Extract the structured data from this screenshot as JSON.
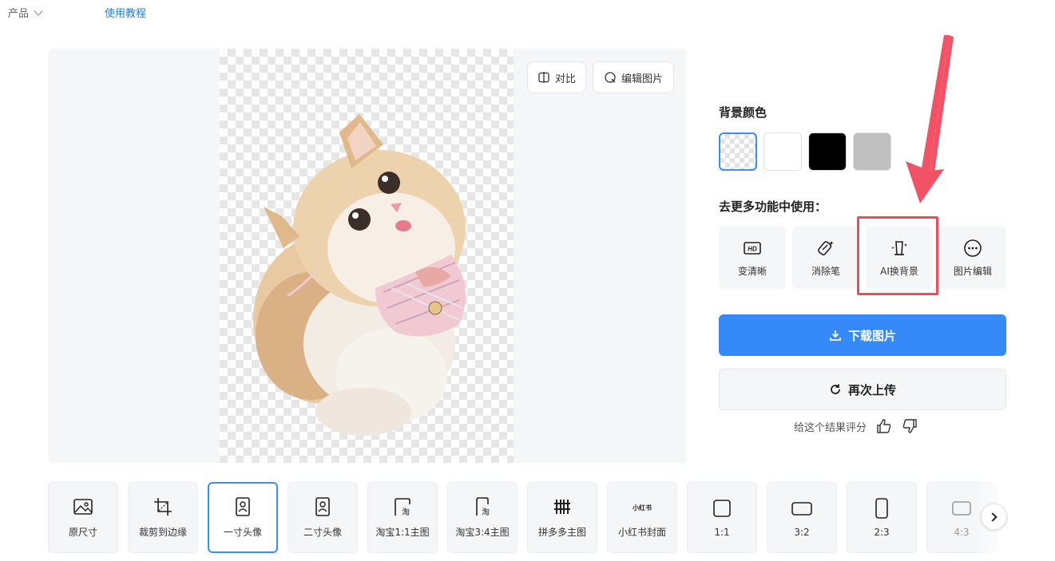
{
  "nav": {
    "product_label": "产品",
    "tutorial_label": "使用教程"
  },
  "preview": {
    "compare_label": "对比",
    "edit_label": "编辑图片"
  },
  "background": {
    "title": "背景颜色",
    "swatches": [
      {
        "name": "transparent",
        "color": "transparent",
        "selected": true
      },
      {
        "name": "white",
        "color": "#ffffff",
        "selected": false
      },
      {
        "name": "black",
        "color": "#000000",
        "selected": false
      },
      {
        "name": "gray",
        "color": "#bfbfbf",
        "selected": false
      }
    ]
  },
  "more_features": {
    "title": "去更多功能中使用：",
    "items": [
      {
        "label": "变清晰",
        "icon": "hd-icon"
      },
      {
        "label": "消除笔",
        "icon": "eraser-icon"
      },
      {
        "label": "AI换背景",
        "icon": "ai-background-icon",
        "highlighted": true
      },
      {
        "label": "图片编辑",
        "icon": "more-dots-icon"
      }
    ]
  },
  "actions": {
    "download_label": "下载图片",
    "reupload_label": "再次上传",
    "rating_label": "给这个结果评分"
  },
  "presets": [
    {
      "label": "原尺寸",
      "icon": "image-icon",
      "selected": false
    },
    {
      "label": "裁剪到边缘",
      "icon": "crop-icon",
      "selected": false
    },
    {
      "label": "一寸头像",
      "icon": "portrait-icon",
      "selected": true
    },
    {
      "label": "二寸头像",
      "icon": "portrait-icon",
      "selected": false
    },
    {
      "label": "淘宝1:1主图",
      "icon": "taobao-icon",
      "selected": false
    },
    {
      "label": "淘宝3:4主图",
      "icon": "taobao-icon",
      "selected": false
    },
    {
      "label": "拼多多主图",
      "icon": "pinduoduo-icon",
      "selected": false
    },
    {
      "label": "小红书封面",
      "icon": "xiaohongshu-icon",
      "icon_text": "小红书",
      "selected": false
    },
    {
      "label": "1:1",
      "icon": "square-icon",
      "selected": false
    },
    {
      "label": "3:2",
      "icon": "landscape-icon",
      "selected": false
    },
    {
      "label": "2:3",
      "icon": "portrait-rect-icon",
      "selected": false
    },
    {
      "label": "4:3",
      "icon": "landscape-icon",
      "selected": false
    }
  ],
  "colors": {
    "accent": "#3589f8",
    "highlight": "#ee4b5c",
    "link": "#1f7fd6"
  }
}
